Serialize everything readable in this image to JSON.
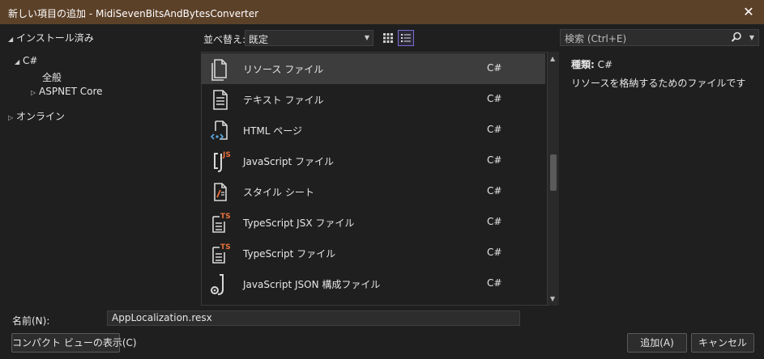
{
  "window": {
    "title": "新しい項目の追加 - MidiSevenBitsAndBytesConverter",
    "close_glyph": "✕"
  },
  "tree": {
    "installed": "インストール済み",
    "csharp": "C#",
    "all": "全般",
    "aspnet": "ASPNET Core",
    "online": "オンライン"
  },
  "sort": {
    "label": "並べ替え:",
    "value": "既定"
  },
  "items": [
    {
      "name": "リソース ファイル",
      "lang": "C#",
      "icon": "resource-file-icon"
    },
    {
      "name": "テキスト ファイル",
      "lang": "C#",
      "icon": "text-file-icon"
    },
    {
      "name": "HTML ページ",
      "lang": "C#",
      "icon": "html-page-icon"
    },
    {
      "name": "JavaScript ファイル",
      "lang": "C#",
      "icon": "javascript-file-icon"
    },
    {
      "name": "スタイル シート",
      "lang": "C#",
      "icon": "style-sheet-icon"
    },
    {
      "name": "TypeScript JSX ファイル",
      "lang": "C#",
      "icon": "typescript-jsx-file-icon"
    },
    {
      "name": "TypeScript ファイル",
      "lang": "C#",
      "icon": "typescript-file-icon"
    },
    {
      "name": "JavaScript JSON 構成ファイル",
      "lang": "C#",
      "icon": "json-config-file-icon"
    }
  ],
  "search": {
    "placeholder": "検索 (Ctrl+E)"
  },
  "details": {
    "type_label": "種類:",
    "type_value": "C#",
    "description": "リソースを格納するためのファイルです"
  },
  "name_field": {
    "label": "名前(N):",
    "value": "AppLocalization.resx"
  },
  "buttons": {
    "compact_view": "コンパクト ビューの表示(C)",
    "add": "追加(A)",
    "cancel": "キャンセル"
  },
  "colors": {
    "title_bar": "#5c4129",
    "background": "#1f1f1f",
    "selection": "#3d3d3d",
    "accent": "#7b6bd6",
    "badge": "#e8703a"
  }
}
